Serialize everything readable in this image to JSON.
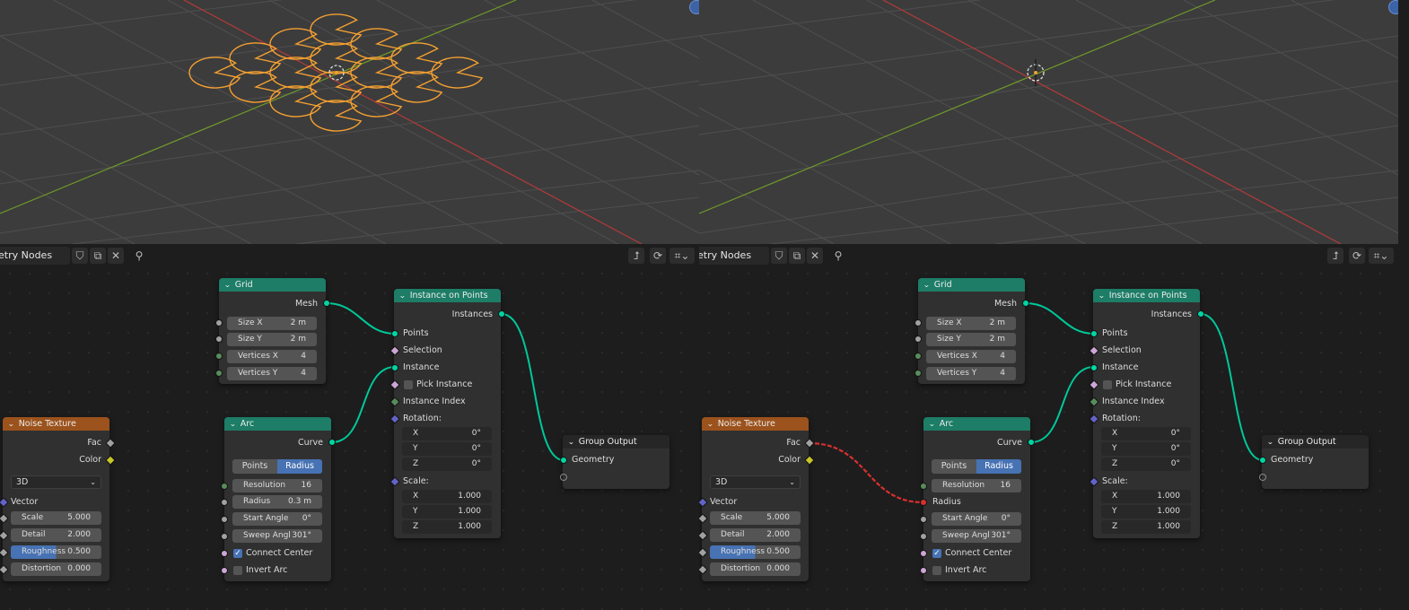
{
  "colors": {
    "geometry_header": "#1d7d67",
    "texture_header": "#9c521c",
    "geometry_socket": "#00d6a3",
    "axis_x": "#b33a3a",
    "axis_y": "#6f9a2a",
    "selection_orange": "#f5a031",
    "bad_link": "#d9302f"
  },
  "header": {
    "node_tree_left": "etry Nodes",
    "node_tree_right": "etry Nodes"
  },
  "icons": {
    "fake_user": "shield-icon",
    "copy": "duplicate-icon",
    "close": "close-icon",
    "pin": "pin-icon",
    "parent": "parent-arrow-icon",
    "snap": "snap-icon",
    "overlay": "overlay-icon"
  },
  "grid": {
    "title": "Grid",
    "out_mesh": "Mesh",
    "size_x_label": "Size X",
    "size_x": "2 m",
    "size_y_label": "Size Y",
    "size_y": "2 m",
    "verts_x_label": "Vertices X",
    "verts_x": "4",
    "verts_y_label": "Vertices Y",
    "verts_y": "4"
  },
  "iop": {
    "title": "Instance on Points",
    "out_instances": "Instances",
    "points": "Points",
    "selection": "Selection",
    "instance": "Instance",
    "pick_instance": "Pick Instance",
    "instance_index": "Instance Index",
    "rotation": "Rotation:",
    "rot_x_label": "X",
    "rot_x": "0°",
    "rot_y_label": "Y",
    "rot_y": "0°",
    "rot_z_label": "Z",
    "rot_z": "0°",
    "scale": "Scale:",
    "sc_x_label": "X",
    "sc_x": "1.000",
    "sc_y_label": "Y",
    "sc_y": "1.000",
    "sc_z_label": "Z",
    "sc_z": "1.000"
  },
  "noise": {
    "title": "Noise Texture",
    "out_fac": "Fac",
    "out_color": "Color",
    "dimensions": "3D",
    "vector": "Vector",
    "scale_label": "Scale",
    "scale": "5.000",
    "detail_label": "Detail",
    "detail": "2.000",
    "roughness_label": "Roughness",
    "roughness": "0.500",
    "distortion_label": "Distortion",
    "distortion": "0.000"
  },
  "arc": {
    "title": "Arc",
    "out_curve": "Curve",
    "mode_points": "Points",
    "mode_radius": "Radius",
    "resolution_label": "Resolution",
    "resolution": "16",
    "radius_label": "Radius",
    "radius": "0.3 m",
    "start_angle_label": "Start Angle",
    "start_angle": "0°",
    "sweep_label": "Sweep Angl",
    "sweep": "301°",
    "connect_center": "Connect Center",
    "invert_arc": "Invert Arc"
  },
  "group_output": {
    "title": "Group Output",
    "geometry": "Geometry"
  }
}
